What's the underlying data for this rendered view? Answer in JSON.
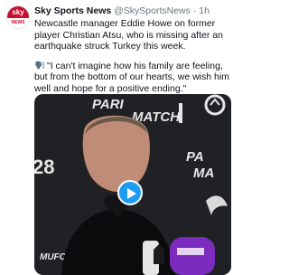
{
  "tweet": {
    "author_name": "Sky Sports News",
    "author_handle": "@SkySportsNews",
    "separator": "·",
    "time": "1h",
    "text_line1": "Newcastle manager Eddie Howe on former player Christian Atsu, who is missing after an earthquake struck Turkey this week.",
    "quote": "\"I can't imagine how his family are feeling, but from the bottom of our hearts, we wish him well and hope for a positive ending.\""
  },
  "avatar": {
    "brand_top": "sky",
    "brand_bottom": "NEWS"
  },
  "media": {
    "backdrop_text_1": "PARI",
    "backdrop_text_2": "MATCH",
    "backdrop_text_3": "PA",
    "backdrop_text_4": "MA",
    "backdrop_text_5": "28",
    "backdrop_text_6": "MUFC TV",
    "play_icon": "play-icon"
  },
  "colors": {
    "accent": "#1d9bf0",
    "brand": "#c8102e",
    "muted": "#6e767d"
  }
}
